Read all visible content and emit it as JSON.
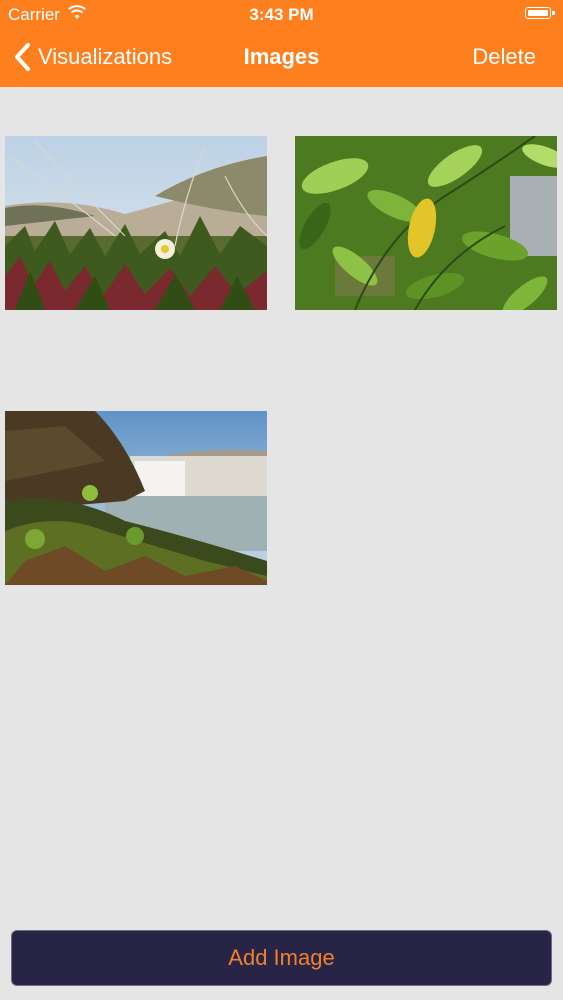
{
  "status_bar": {
    "carrier": "Carrier",
    "time": "3:43 PM"
  },
  "nav": {
    "back_label": "Visualizations",
    "title": "Images",
    "delete_label": "Delete",
    "color": "#fd7f1e"
  },
  "images": [
    {
      "subject": "coastal dune grass with ice plant and a small white-yellow flower"
    },
    {
      "subject": "green leafy branches with one yellow leaf"
    },
    {
      "subject": "waterfall with mist beside a mossy rocky shore"
    }
  ],
  "footer": {
    "add_label": "Add Image",
    "button_color": "#272446",
    "text_color": "#f08030"
  }
}
